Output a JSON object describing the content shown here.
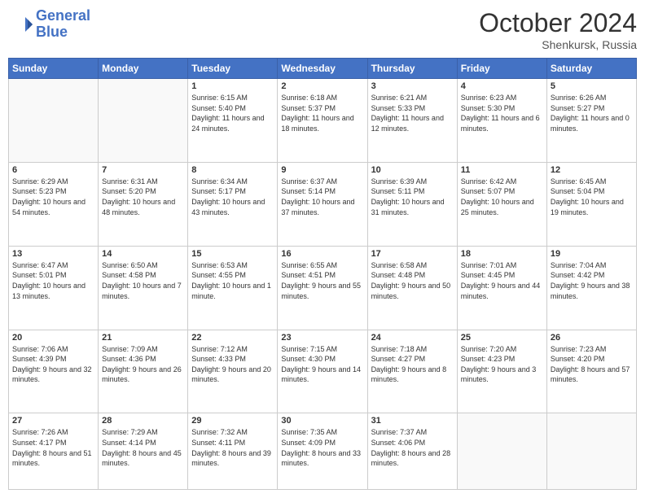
{
  "header": {
    "logo_line1": "General",
    "logo_line2": "Blue",
    "month": "October 2024",
    "location": "Shenkursk, Russia"
  },
  "days_of_week": [
    "Sunday",
    "Monday",
    "Tuesday",
    "Wednesday",
    "Thursday",
    "Friday",
    "Saturday"
  ],
  "weeks": [
    [
      {
        "num": "",
        "info": ""
      },
      {
        "num": "",
        "info": ""
      },
      {
        "num": "1",
        "info": "Sunrise: 6:15 AM\nSunset: 5:40 PM\nDaylight: 11 hours and 24 minutes."
      },
      {
        "num": "2",
        "info": "Sunrise: 6:18 AM\nSunset: 5:37 PM\nDaylight: 11 hours and 18 minutes."
      },
      {
        "num": "3",
        "info": "Sunrise: 6:21 AM\nSunset: 5:33 PM\nDaylight: 11 hours and 12 minutes."
      },
      {
        "num": "4",
        "info": "Sunrise: 6:23 AM\nSunset: 5:30 PM\nDaylight: 11 hours and 6 minutes."
      },
      {
        "num": "5",
        "info": "Sunrise: 6:26 AM\nSunset: 5:27 PM\nDaylight: 11 hours and 0 minutes."
      }
    ],
    [
      {
        "num": "6",
        "info": "Sunrise: 6:29 AM\nSunset: 5:23 PM\nDaylight: 10 hours and 54 minutes."
      },
      {
        "num": "7",
        "info": "Sunrise: 6:31 AM\nSunset: 5:20 PM\nDaylight: 10 hours and 48 minutes."
      },
      {
        "num": "8",
        "info": "Sunrise: 6:34 AM\nSunset: 5:17 PM\nDaylight: 10 hours and 43 minutes."
      },
      {
        "num": "9",
        "info": "Sunrise: 6:37 AM\nSunset: 5:14 PM\nDaylight: 10 hours and 37 minutes."
      },
      {
        "num": "10",
        "info": "Sunrise: 6:39 AM\nSunset: 5:11 PM\nDaylight: 10 hours and 31 minutes."
      },
      {
        "num": "11",
        "info": "Sunrise: 6:42 AM\nSunset: 5:07 PM\nDaylight: 10 hours and 25 minutes."
      },
      {
        "num": "12",
        "info": "Sunrise: 6:45 AM\nSunset: 5:04 PM\nDaylight: 10 hours and 19 minutes."
      }
    ],
    [
      {
        "num": "13",
        "info": "Sunrise: 6:47 AM\nSunset: 5:01 PM\nDaylight: 10 hours and 13 minutes."
      },
      {
        "num": "14",
        "info": "Sunrise: 6:50 AM\nSunset: 4:58 PM\nDaylight: 10 hours and 7 minutes."
      },
      {
        "num": "15",
        "info": "Sunrise: 6:53 AM\nSunset: 4:55 PM\nDaylight: 10 hours and 1 minute."
      },
      {
        "num": "16",
        "info": "Sunrise: 6:55 AM\nSunset: 4:51 PM\nDaylight: 9 hours and 55 minutes."
      },
      {
        "num": "17",
        "info": "Sunrise: 6:58 AM\nSunset: 4:48 PM\nDaylight: 9 hours and 50 minutes."
      },
      {
        "num": "18",
        "info": "Sunrise: 7:01 AM\nSunset: 4:45 PM\nDaylight: 9 hours and 44 minutes."
      },
      {
        "num": "19",
        "info": "Sunrise: 7:04 AM\nSunset: 4:42 PM\nDaylight: 9 hours and 38 minutes."
      }
    ],
    [
      {
        "num": "20",
        "info": "Sunrise: 7:06 AM\nSunset: 4:39 PM\nDaylight: 9 hours and 32 minutes."
      },
      {
        "num": "21",
        "info": "Sunrise: 7:09 AM\nSunset: 4:36 PM\nDaylight: 9 hours and 26 minutes."
      },
      {
        "num": "22",
        "info": "Sunrise: 7:12 AM\nSunset: 4:33 PM\nDaylight: 9 hours and 20 minutes."
      },
      {
        "num": "23",
        "info": "Sunrise: 7:15 AM\nSunset: 4:30 PM\nDaylight: 9 hours and 14 minutes."
      },
      {
        "num": "24",
        "info": "Sunrise: 7:18 AM\nSunset: 4:27 PM\nDaylight: 9 hours and 8 minutes."
      },
      {
        "num": "25",
        "info": "Sunrise: 7:20 AM\nSunset: 4:23 PM\nDaylight: 9 hours and 3 minutes."
      },
      {
        "num": "26",
        "info": "Sunrise: 7:23 AM\nSunset: 4:20 PM\nDaylight: 8 hours and 57 minutes."
      }
    ],
    [
      {
        "num": "27",
        "info": "Sunrise: 7:26 AM\nSunset: 4:17 PM\nDaylight: 8 hours and 51 minutes."
      },
      {
        "num": "28",
        "info": "Sunrise: 7:29 AM\nSunset: 4:14 PM\nDaylight: 8 hours and 45 minutes."
      },
      {
        "num": "29",
        "info": "Sunrise: 7:32 AM\nSunset: 4:11 PM\nDaylight: 8 hours and 39 minutes."
      },
      {
        "num": "30",
        "info": "Sunrise: 7:35 AM\nSunset: 4:09 PM\nDaylight: 8 hours and 33 minutes."
      },
      {
        "num": "31",
        "info": "Sunrise: 7:37 AM\nSunset: 4:06 PM\nDaylight: 8 hours and 28 minutes."
      },
      {
        "num": "",
        "info": ""
      },
      {
        "num": "",
        "info": ""
      }
    ]
  ]
}
